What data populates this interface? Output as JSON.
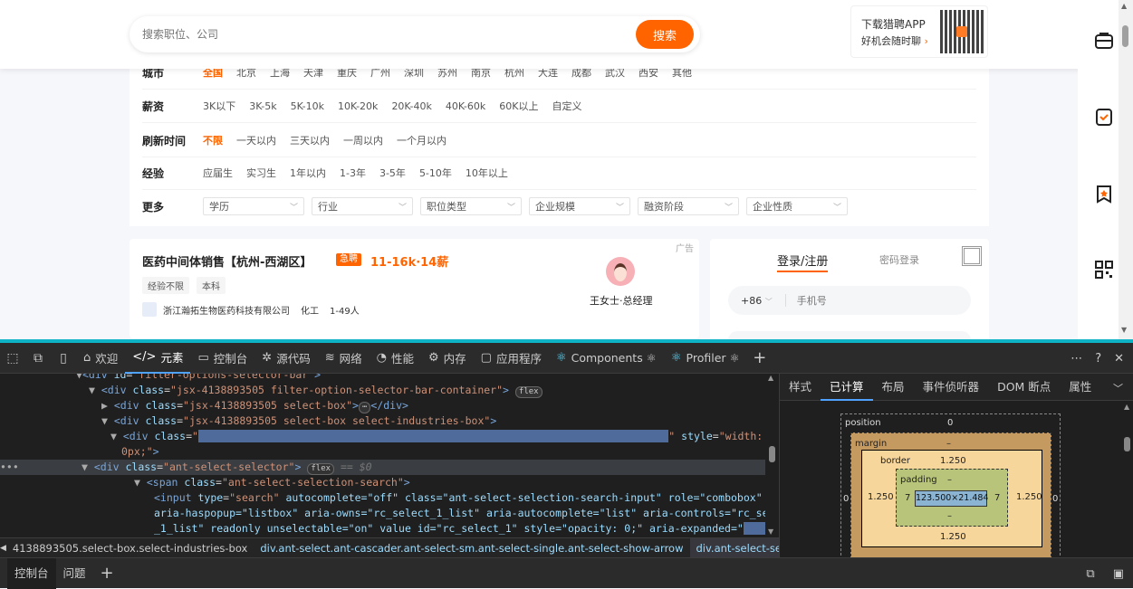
{
  "search": {
    "placeholder": "搜索职位、公司",
    "button": "搜索"
  },
  "app_promo": {
    "title": "下载猎聘APP",
    "subtitle": "好机会随时聊",
    "arrow": "›"
  },
  "filters": {
    "city": {
      "label": "城市",
      "options": [
        "全国",
        "北京",
        "上海",
        "天津",
        "重庆",
        "广州",
        "深圳",
        "苏州",
        "南京",
        "杭州",
        "大连",
        "成都",
        "武汉",
        "西安",
        "其他"
      ],
      "active": "全国"
    },
    "salary": {
      "label": "薪资",
      "options": [
        "3K以下",
        "3K-5k",
        "5K-10k",
        "10K-20k",
        "20K-40k",
        "40K-60k",
        "60K以上",
        "自定义"
      ]
    },
    "refresh": {
      "label": "刷新时间",
      "options": [
        "不限",
        "一天以内",
        "三天以内",
        "一周以内",
        "一个月以内"
      ],
      "active": "不限"
    },
    "experience": {
      "label": "经验",
      "options": [
        "应届生",
        "实习生",
        "1年以内",
        "1-3年",
        "3-5年",
        "5-10年",
        "10年以上"
      ]
    },
    "more": {
      "label": "更多",
      "dropdowns": [
        "学历",
        "行业",
        "职位类型",
        "企业规模",
        "融资阶段",
        "企业性质"
      ]
    }
  },
  "job": {
    "title": "医药中间体销售【杭州-西湖区】",
    "urgent": "急聘",
    "salary": "11-16k·14薪",
    "ad": "广告",
    "tags": [
      "经验不限",
      "本科"
    ],
    "company": "浙江瀚拓生物医药科技有限公司",
    "industry": "化工",
    "size": "1-49人",
    "recruiter": "王女士·总经理"
  },
  "login": {
    "tab_active": "登录/注册",
    "tab_other": "密码登录",
    "country_code": "+86",
    "phone_placeholder": "手机号"
  },
  "devtools": {
    "tabs": [
      {
        "icon": "⌂",
        "label": "欢迎"
      },
      {
        "icon": "</>",
        "label": "元素"
      },
      {
        "icon": "▭",
        "label": "控制台"
      },
      {
        "icon": "✲",
        "label": "源代码"
      },
      {
        "icon": "≋",
        "label": "网络"
      },
      {
        "icon": "◔",
        "label": "性能"
      },
      {
        "icon": "⚙",
        "label": "内存"
      },
      {
        "icon": "▢",
        "label": "应用程序"
      },
      {
        "icon": "⚛",
        "label": "Components ⚛"
      },
      {
        "icon": "⚛",
        "label": "Profiler ⚛"
      }
    ],
    "dom": {
      "l0": "filter-options-selector-bar",
      "l1_class": "jsx-4138893505 filter-option-selector-bar-container",
      "l2_class": "jsx-4138893505 select-box",
      "l3_class": "jsx-4138893505 select-box select-industries-box",
      "l4_style": "width: 14",
      "l4b": "0px;",
      "l5_class": "ant-select-selector",
      "l6_class": "ant-select-selection-search",
      "l7": "autocomplete=\"off\" class=\"ant-select-selection-search-input\" role=\"combobox\"",
      "l8": "aria-haspopup=\"listbox\" aria-owns=\"rc_select_1_list\" aria-autocomplete=\"list\" aria-controls=\"rc_select",
      "l9": "_1_list\" readonly unselectable=\"on\" value id=\"rc_select_1\" style=\"opacity: 0;\" aria-expanded=\"",
      "flex": "flex",
      "eq": "== $0"
    },
    "breadcrumbs": [
      "4138893505.select-box.select-industries-box",
      "div.ant-select.ant-cascader.ant-select-sm.ant-select-single.ant-select-show-arrow",
      "div.ant-select-selector"
    ],
    "styles_tabs": [
      "样式",
      "已计算",
      "布局",
      "事件侦听器",
      "DOM 断点",
      "属性"
    ],
    "boxmodel": {
      "position_label": "position",
      "position": "0",
      "margin_label": "margin",
      "margin": "–",
      "border_label": "border",
      "border": "1.250",
      "padding_label": "padding",
      "padding": "–",
      "content": "123.500×21.484",
      "left": "0",
      "right": "0",
      "border_side": "1.250",
      "padding_side": "7",
      "bottom_border": "1.250",
      "dash": "–"
    },
    "drawer_tabs": [
      "控制台",
      "问题"
    ]
  }
}
